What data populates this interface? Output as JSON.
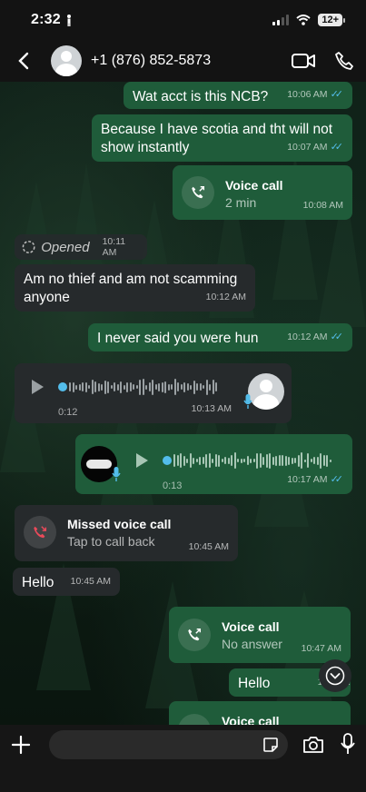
{
  "status_bar": {
    "time": "2:32",
    "battery": "12+"
  },
  "header": {
    "contact": "+1 (876) 852-5873"
  },
  "messages": {
    "m1": {
      "text": "Wat acct is this NCB?",
      "time": "10:06 AM"
    },
    "m2": {
      "text": "Because I have scotia and tht will not show instantly",
      "time": "10:07 AM"
    },
    "m3": {
      "title": "Voice call",
      "sub": "2 min",
      "time": "10:08 AM"
    },
    "opened": {
      "text": "Opened",
      "time": "10:11 AM"
    },
    "m4": {
      "text": "Am no thief and am not scamming anyone",
      "time": "10:12 AM"
    },
    "m5": {
      "text": "I never said you were hun",
      "time": "10:12 AM"
    },
    "m6": {
      "duration": "0:12",
      "time": "10:13 AM"
    },
    "m7": {
      "duration": "0:13",
      "time": "10:17 AM"
    },
    "m8": {
      "title": "Missed voice call",
      "sub": "Tap to call back",
      "time": "10:45 AM"
    },
    "m9": {
      "text": "Hello",
      "time": "10:45 AM"
    },
    "m10": {
      "title": "Voice call",
      "sub": "No answer",
      "time": "10:47 AM"
    },
    "m11": {
      "text": "Hello",
      "time": "10:49 AM"
    },
    "m12": {
      "title": "Voice call"
    }
  },
  "composer": {
    "placeholder": ""
  },
  "colors": {
    "outgoing": "#1f5c3a",
    "incoming": "#262a2c",
    "read_ticks": "#53bdeb",
    "missed": "#ea4a5a"
  }
}
